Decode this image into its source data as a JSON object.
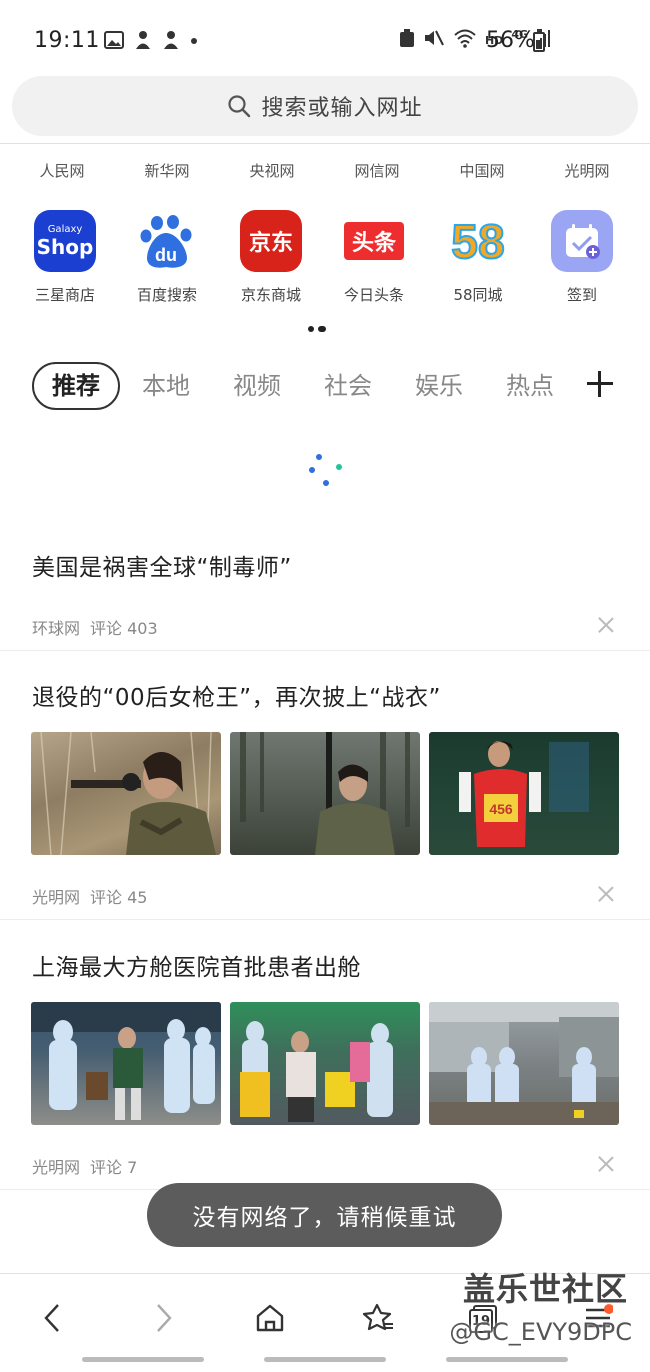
{
  "status_bar": {
    "time": "19:11",
    "battery": "56%",
    "network": "4G",
    "hd_label": "HD"
  },
  "search": {
    "placeholder": "搜索或输入网址"
  },
  "quick_links": [
    "人民网",
    "新华网",
    "央视网",
    "网信网",
    "中国网",
    "光明网"
  ],
  "apps": [
    {
      "label": "三星商店",
      "icon": "galaxy-shop-icon",
      "icon_text_1": "Galaxy",
      "icon_text_2": "Shop",
      "color": "#1b3fd1"
    },
    {
      "label": "百度搜索",
      "icon": "baidu-icon",
      "icon_text": "du",
      "color": "#2f6fe0"
    },
    {
      "label": "京东商城",
      "icon": "jd-icon",
      "icon_text": "京东",
      "color": "#e1251b"
    },
    {
      "label": "今日头条",
      "icon": "toutiao-icon",
      "icon_text": "头条",
      "color": "#ee2e2e"
    },
    {
      "label": "58同城",
      "icon": "58-icon",
      "icon_text": "58",
      "color": "#ffffff"
    },
    {
      "label": "签到",
      "icon": "checkin-calendar-icon",
      "color": "#9aa6f3"
    }
  ],
  "tabs": [
    "推荐",
    "本地",
    "视频",
    "社会",
    "娱乐",
    "热点"
  ],
  "articles": [
    {
      "title": "美国是祸害全球“制毒师”",
      "source": "环球网",
      "comments": "评论 403"
    },
    {
      "title": "退役的“00后女枪王”，再次披上“战衣”",
      "source": "光明网",
      "comments": "评论 45",
      "bib_number": "456"
    },
    {
      "title": "上海最大方舱医院首批患者出舱",
      "source": "光明网",
      "comments": "评论 7"
    }
  ],
  "toast": "没有网络了，请稍候重试",
  "bottom_nav": {
    "tab_count": "19"
  },
  "watermark": {
    "line1": "盖乐世社区",
    "line2": "@GC_EVY9DPC"
  }
}
